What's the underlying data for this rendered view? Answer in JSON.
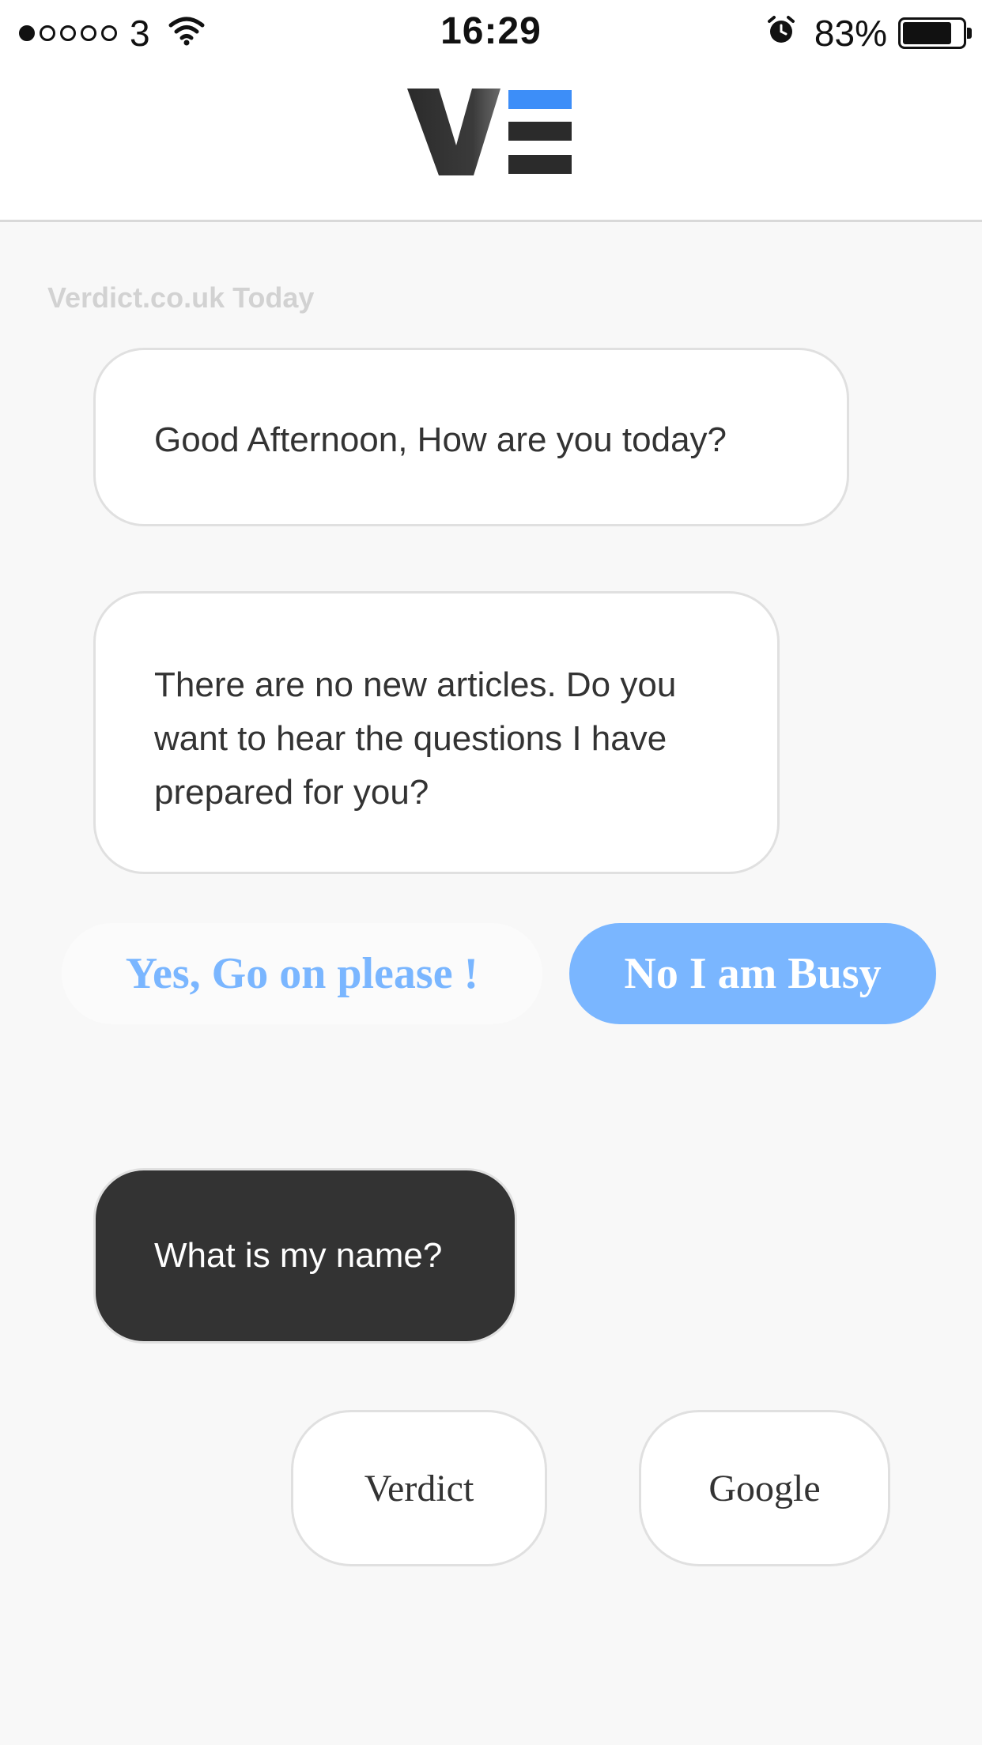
{
  "status_bar": {
    "carrier": "3",
    "time": "16:29",
    "battery_percent": "83%",
    "battery_level": 0.83,
    "signal_bars_filled": 1,
    "signal_bars_total": 5,
    "icons": [
      "wifi-icon",
      "alarm-icon",
      "battery-icon"
    ]
  },
  "header": {
    "logo": "VE",
    "colors": {
      "logo_dark": "#2b2b2b",
      "logo_accent": "#3d8ef8"
    }
  },
  "chat": {
    "day_label": "Verdict.co.uk Today",
    "messages": [
      {
        "text": "Good Afternoon, How are you today?"
      },
      {
        "text": "There are no new articles. Do you want to hear the questions I have prepared for you?"
      }
    ],
    "quick_replies": [
      {
        "label": "Yes, Go on please !"
      },
      {
        "label": "No I am Busy"
      }
    ],
    "selected_message": {
      "text": "What is my name?"
    },
    "options": [
      {
        "label": "Verdict"
      },
      {
        "label": "Google"
      }
    ]
  },
  "colors": {
    "accent_blue": "#7ab6ff",
    "dark_bubble": "#333333",
    "background": "#f8f8f8"
  }
}
